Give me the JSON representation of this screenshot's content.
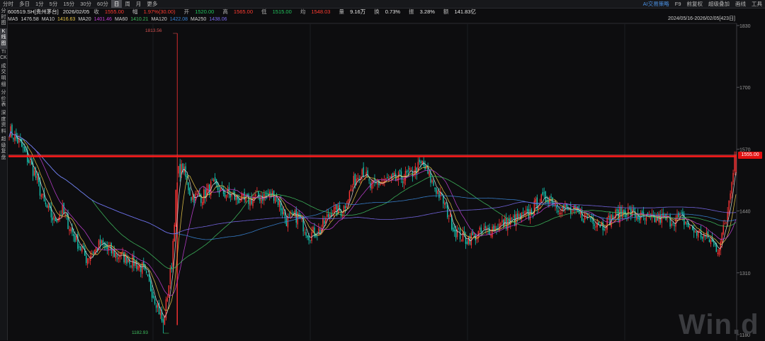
{
  "toolbar": {
    "tabs": [
      "分时",
      "多日",
      "1分",
      "5分",
      "15分",
      "30分",
      "60分",
      "日",
      "周",
      "月",
      "更多"
    ],
    "active_tab": "日",
    "right_items": [
      "AI交易策略",
      "F9",
      "前复权",
      "超级叠加",
      "画线",
      "工具"
    ]
  },
  "sidebar": {
    "items": [
      "分时图",
      "K线图",
      "TICK",
      "成交明细",
      "分价表",
      "深度资料",
      "超级复盘"
    ],
    "active_item": "K线图"
  },
  "info": {
    "code": "600519.SH[贵州茅台]",
    "date": "2026/02/05",
    "close_label": "收",
    "close": "1555.00",
    "change_label": "幅",
    "change": "1.97%(30.00)",
    "open_label": "开",
    "open": "1520.00",
    "high_label": "高",
    "high": "1565.00",
    "low_label": "低",
    "low": "1515.00",
    "avg_label": "均",
    "avg": "1548.03",
    "vol_label": "量",
    "vol": "9.16万",
    "turn_label": "换",
    "turn": "0.73%",
    "amp_label": "振",
    "amp": "3.28%",
    "amt_label": "额",
    "amt": "141.83亿"
  },
  "ma": [
    {
      "label": "MA5",
      "value": "1476.58",
      "color": "#d8d8d8"
    },
    {
      "label": "MA10",
      "value": "1416.63",
      "color": "#e7c547"
    },
    {
      "label": "MA20",
      "value": "1401.46",
      "color": "#c13fd4"
    },
    {
      "label": "MA60",
      "value": "1410.21",
      "color": "#3fbf5f"
    },
    {
      "label": "MA120",
      "value": "1422.08",
      "color": "#3a86d8"
    },
    {
      "label": "MA250",
      "value": "1438.06",
      "color": "#7b6cf0"
    }
  ],
  "range_text": "2024/05/16-2026/02/05[423日]",
  "price_axis": {
    "ticks": [
      "1830",
      "1700",
      "1570",
      "1440",
      "1310",
      "1180"
    ],
    "last_price_label": "1555.00",
    "high_marker": "1813.56",
    "low_marker": "1182.93"
  },
  "chart_data": {
    "type": "candlestick",
    "yrange": [
      1180,
      1830
    ],
    "last_price": 1555.0,
    "max_high": 1813.56,
    "min_low": 1182.93,
    "close_trend": [
      [
        0,
        1610
      ],
      [
        8,
        1580
      ],
      [
        18,
        1520
      ],
      [
        25,
        1455
      ],
      [
        32,
        1420
      ],
      [
        38,
        1440
      ],
      [
        45,
        1395
      ],
      [
        55,
        1340
      ],
      [
        65,
        1370
      ],
      [
        75,
        1350
      ],
      [
        85,
        1340
      ],
      [
        95,
        1320
      ],
      [
        105,
        1250
      ],
      [
        110,
        1200
      ],
      [
        116,
        1330
      ],
      [
        120,
        1520
      ],
      [
        124,
        1530
      ],
      [
        130,
        1470
      ],
      [
        138,
        1470
      ],
      [
        145,
        1495
      ],
      [
        152,
        1480
      ],
      [
        160,
        1470
      ],
      [
        168,
        1460
      ],
      [
        178,
        1470
      ],
      [
        190,
        1475
      ],
      [
        198,
        1420
      ],
      [
        206,
        1430
      ],
      [
        214,
        1390
      ],
      [
        222,
        1400
      ],
      [
        230,
        1440
      ],
      [
        238,
        1440
      ],
      [
        246,
        1500
      ],
      [
        252,
        1530
      ],
      [
        258,
        1490
      ],
      [
        265,
        1500
      ],
      [
        272,
        1505
      ],
      [
        280,
        1510
      ],
      [
        288,
        1520
      ],
      [
        295,
        1540
      ],
      [
        302,
        1500
      ],
      [
        310,
        1460
      ],
      [
        318,
        1400
      ],
      [
        326,
        1380
      ],
      [
        334,
        1390
      ],
      [
        342,
        1400
      ],
      [
        350,
        1410
      ],
      [
        360,
        1420
      ],
      [
        370,
        1430
      ],
      [
        378,
        1460
      ],
      [
        386,
        1470
      ],
      [
        392,
        1450
      ],
      [
        400,
        1440
      ],
      [
        408,
        1430
      ],
      [
        416,
        1425
      ],
      [
        424,
        1410
      ],
      [
        432,
        1430
      ],
      [
        440,
        1440
      ],
      [
        448,
        1430
      ],
      [
        456,
        1420
      ],
      [
        464,
        1425
      ],
      [
        472,
        1420
      ],
      [
        480,
        1425
      ],
      [
        488,
        1400
      ],
      [
        494,
        1390
      ],
      [
        500,
        1380
      ],
      [
        506,
        1360
      ],
      [
        512,
        1420
      ],
      [
        518,
        1555
      ]
    ]
  }
}
